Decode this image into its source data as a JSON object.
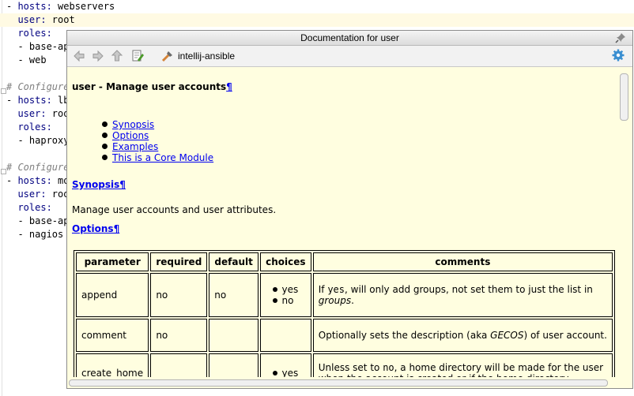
{
  "editor": {
    "lines": [
      {
        "parts": [
          {
            "t": "- ",
            "c": ""
          },
          {
            "t": "hosts:",
            "c": "k"
          },
          {
            "t": " webservers",
            "c": ""
          }
        ]
      },
      {
        "parts": [
          {
            "t": "  ",
            "c": ""
          },
          {
            "t": "user:",
            "c": "k"
          },
          {
            "t": " root",
            "c": ""
          }
        ],
        "highlight": true
      },
      {
        "parts": [
          {
            "t": "  ",
            "c": ""
          },
          {
            "t": "roles:",
            "c": "k"
          }
        ]
      },
      {
        "parts": [
          {
            "t": "  - base-apache",
            "c": ""
          }
        ]
      },
      {
        "parts": [
          {
            "t": "  - web",
            "c": ""
          }
        ]
      },
      {
        "parts": [
          {
            "t": "",
            "c": ""
          }
        ]
      },
      {
        "parts": [
          {
            "t": "# Configure and deploy the load balancer(s).",
            "c": "cm"
          }
        ]
      },
      {
        "parts": [
          {
            "t": "- ",
            "c": ""
          },
          {
            "t": "hosts:",
            "c": "k"
          },
          {
            "t": " lbservers",
            "c": ""
          }
        ]
      },
      {
        "parts": [
          {
            "t": "  ",
            "c": ""
          },
          {
            "t": "user:",
            "c": "k"
          },
          {
            "t": " root",
            "c": ""
          }
        ]
      },
      {
        "parts": [
          {
            "t": "  ",
            "c": ""
          },
          {
            "t": "roles:",
            "c": "k"
          }
        ]
      },
      {
        "parts": [
          {
            "t": "  - haproxy",
            "c": ""
          }
        ]
      },
      {
        "parts": [
          {
            "t": "",
            "c": ""
          }
        ]
      },
      {
        "parts": [
          {
            "t": "# Configure and deploy the Nagios monitoring node(s).",
            "c": "cm"
          }
        ]
      },
      {
        "parts": [
          {
            "t": "- ",
            "c": ""
          },
          {
            "t": "hosts:",
            "c": "k"
          },
          {
            "t": " monitoring",
            "c": ""
          }
        ]
      },
      {
        "parts": [
          {
            "t": "  ",
            "c": ""
          },
          {
            "t": "user:",
            "c": "k"
          },
          {
            "t": " root",
            "c": ""
          }
        ]
      },
      {
        "parts": [
          {
            "t": "  ",
            "c": ""
          },
          {
            "t": "roles:",
            "c": "k"
          }
        ]
      },
      {
        "parts": [
          {
            "t": "  - base-apache",
            "c": ""
          }
        ]
      },
      {
        "parts": [
          {
            "t": "  - nagios",
            "c": ""
          }
        ]
      }
    ]
  },
  "popup": {
    "title": "Documentation for user",
    "toolbar": {
      "back_icon": "arrow-left-icon",
      "forward_icon": "arrow-right-icon",
      "up_icon": "arrow-up-icon",
      "edit_source_icon": "edit-source-icon",
      "plugin_label": "intellij-ansible",
      "settings_icon": "gear-icon"
    },
    "heading": "user - Manage user accounts",
    "pilcrow": "¶",
    "toc": [
      "Synopsis",
      "Options",
      "Examples",
      "This is a Core Module"
    ],
    "synopsis_heading": "Synopsis¶",
    "synopsis_text": "Manage user accounts and user attributes.",
    "options_heading": "Options¶",
    "table": {
      "headers": [
        "parameter",
        "required",
        "default",
        "choices",
        "comments"
      ],
      "rows": [
        {
          "parameter": "append",
          "required": "no",
          "default": "no",
          "choices": [
            "yes",
            "no"
          ],
          "comments": [
            {
              "t": "If ",
              "c": ""
            },
            {
              "t": "yes",
              "c": "mono"
            },
            {
              "t": ", will only add groups, not set them to just the list in",
              "c": ""
            },
            {
              "br": true
            },
            {
              "t": "groups",
              "c": "em"
            },
            {
              "t": ".",
              "c": ""
            }
          ]
        },
        {
          "parameter": "comment",
          "required": "no",
          "default": "",
          "choices": [],
          "comments": [
            {
              "t": "Optionally sets the description (aka ",
              "c": ""
            },
            {
              "t": "GECOS",
              "c": "em"
            },
            {
              "t": ") of user account.",
              "c": ""
            }
          ]
        },
        {
          "parameter": "create_home",
          "required": "",
          "default": "",
          "choices": [
            "yes"
          ],
          "comments": [
            {
              "t": "Unless set to ",
              "c": ""
            },
            {
              "t": "no",
              "c": "mono"
            },
            {
              "t": ", a home directory will be made for the user",
              "c": ""
            },
            {
              "br": true
            },
            {
              "t": "when the account is created or if the home directory",
              "c": ""
            }
          ]
        }
      ]
    }
  },
  "colors": {
    "link": "#0000ee",
    "doc_bg": "#fffee0",
    "keyword": "#000080",
    "comment": "#808080"
  }
}
